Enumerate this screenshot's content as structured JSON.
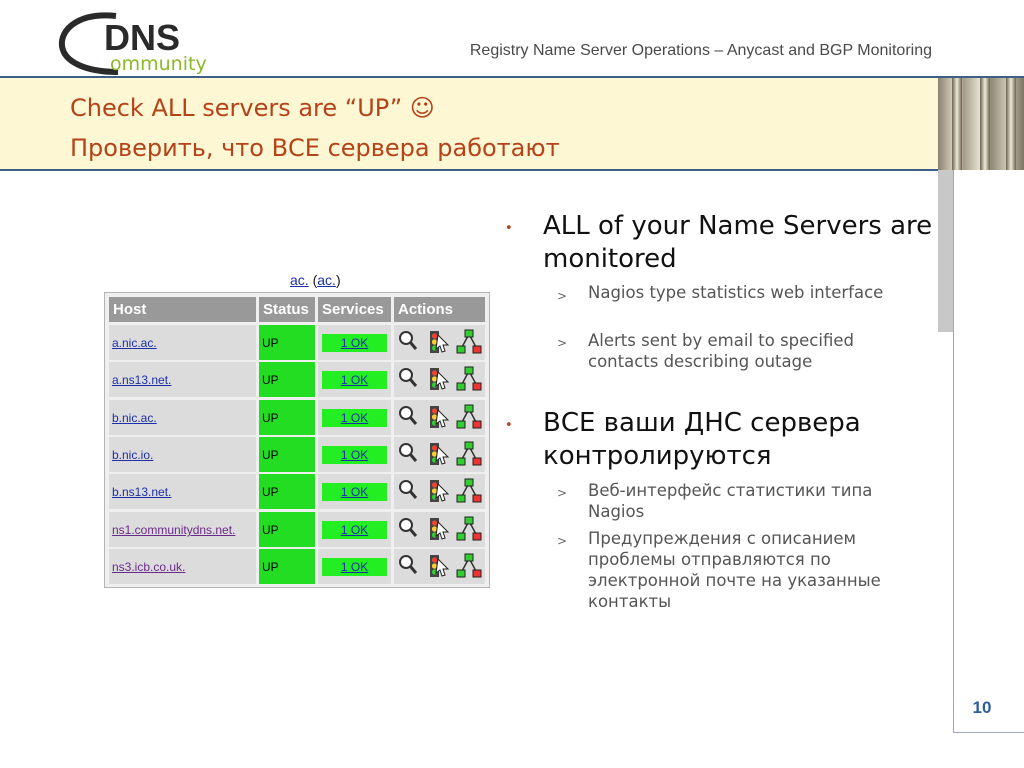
{
  "header": {
    "logo_text_main": "DNS",
    "logo_text_sub": "ommunity",
    "title": "Registry Name Server Operations – Anycast and BGP Monitoring"
  },
  "slide": {
    "title_en": "Check ALL servers are “UP” ☺",
    "title_ru": "Проверить, что ВСЕ сервера работают",
    "page_number": "10"
  },
  "nagios": {
    "heading_prefix": "ac.",
    "heading_link": "ac.",
    "columns": [
      "Host",
      "Status",
      "Services",
      "Actions"
    ],
    "rows": [
      {
        "host": "a.nic.ac.",
        "status": "UP",
        "services": "1 OK"
      },
      {
        "host": "a.ns13.net.",
        "status": "UP",
        "services": "1 OK"
      },
      {
        "host": "b.nic.ac.",
        "status": "UP",
        "services": "1 OK"
      },
      {
        "host": "b.nic.io.",
        "status": "UP",
        "services": "1 OK"
      },
      {
        "host": "b.ns13.net.",
        "status": "UP",
        "services": "1 OK"
      },
      {
        "host": "ns1.communitydns.net.",
        "status": "UP",
        "services": "1 OK"
      },
      {
        "host": "ns3.icb.co.uk.",
        "status": "UP",
        "services": "1 OK"
      }
    ],
    "colors": {
      "status_ok": "#22dd22",
      "header_bg": "#999999",
      "link": "#1c2fa8"
    }
  },
  "bullets": [
    {
      "text": "ALL of your Name Servers are monitored",
      "subs": [
        "Nagios type statistics web interface",
        "Alerts sent by email to specified contacts describing outage"
      ]
    },
    {
      "text": "ВСЕ ваши ДНС сервера контролируются",
      "subs": [
        "Веб-интерфейс статистики типа Nagios",
        "Предупреждения с описанием проблемы отправляются по электронной почте на указанные контакты"
      ]
    }
  ],
  "theme": {
    "title_color": "#b5431a",
    "accent_line": "#3f5f86",
    "band_bg": "#fdf7d3",
    "page_num_color": "#2f5c9e"
  }
}
